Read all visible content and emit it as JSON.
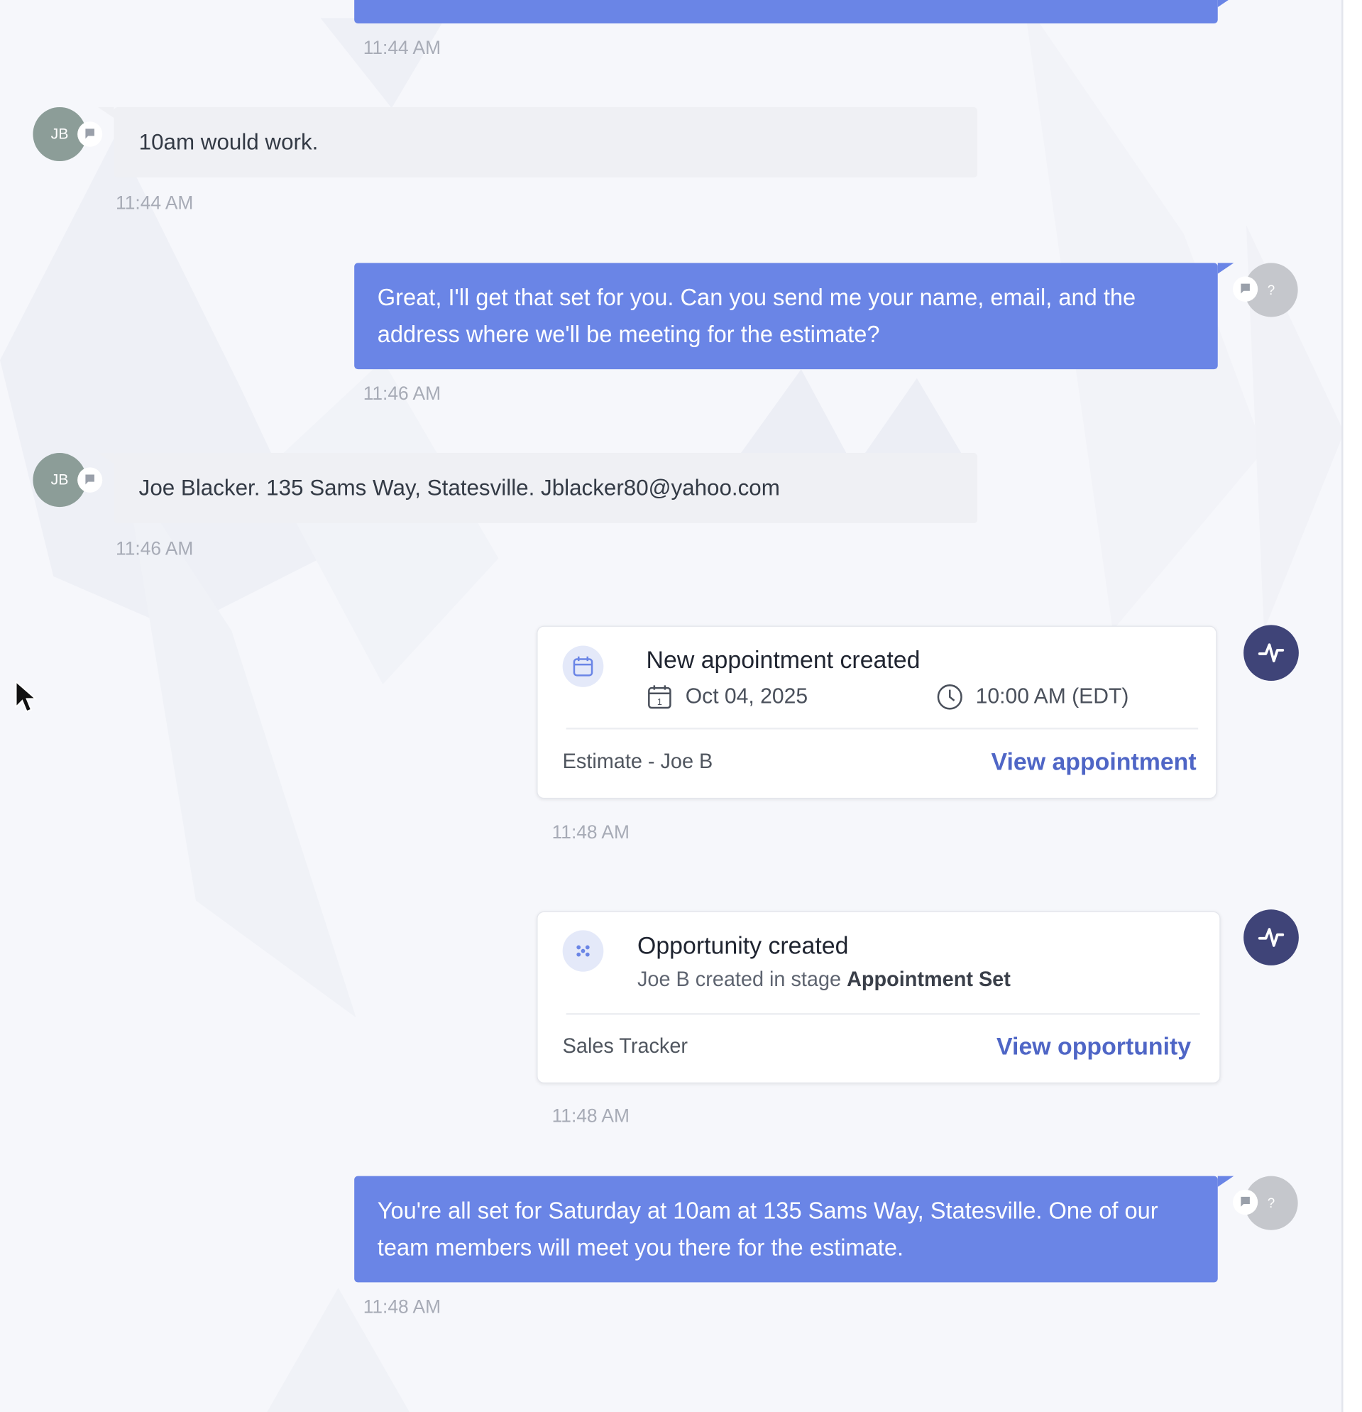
{
  "messages": [
    {
      "time": "11:44 AM"
    },
    {
      "text": "10am would work.",
      "time": "11:44 AM",
      "avatar_initials": "JB"
    },
    {
      "text": "Great, I'll get that set for you. Can you send me your name, email, and the address where we'll be meeting for the estimate?",
      "time": "11:46 AM",
      "avatar_initials": "?"
    },
    {
      "text": "Joe Blacker. 135 Sams Way, Statesville. Jblacker80@yahoo.com",
      "time": "11:46 AM",
      "avatar_initials": "JB"
    },
    {
      "text": "You're all set for Saturday at 10am at 135 Sams Way, Statesville. One of our team members will meet you there for the estimate.",
      "time": "11:48 AM",
      "avatar_initials": "?"
    }
  ],
  "appointment_card": {
    "title": "New appointment created",
    "date": "Oct 04, 2025",
    "time": "10:00 AM (EDT)",
    "footer": "Estimate - Joe B",
    "link": "View appointment",
    "timestamp": "11:48 AM"
  },
  "opportunity_card": {
    "title": "Opportunity created",
    "sub_prefix": "Joe B created in stage",
    "stage": "Appointment Set",
    "footer": "Sales Tracker",
    "link": "View opportunity",
    "timestamp": "11:48 AM"
  },
  "colors": {
    "outgoing_bubble": "#6a85e6",
    "incoming_bubble": "#eff0f4",
    "activity_avatar": "#3f4478",
    "link": "#4f66c6"
  },
  "icons": [
    "chat-channel-icon",
    "calendar-icon",
    "clock-icon",
    "activity-pulse-icon",
    "opportunity-icon",
    "mouse-cursor-icon"
  ]
}
